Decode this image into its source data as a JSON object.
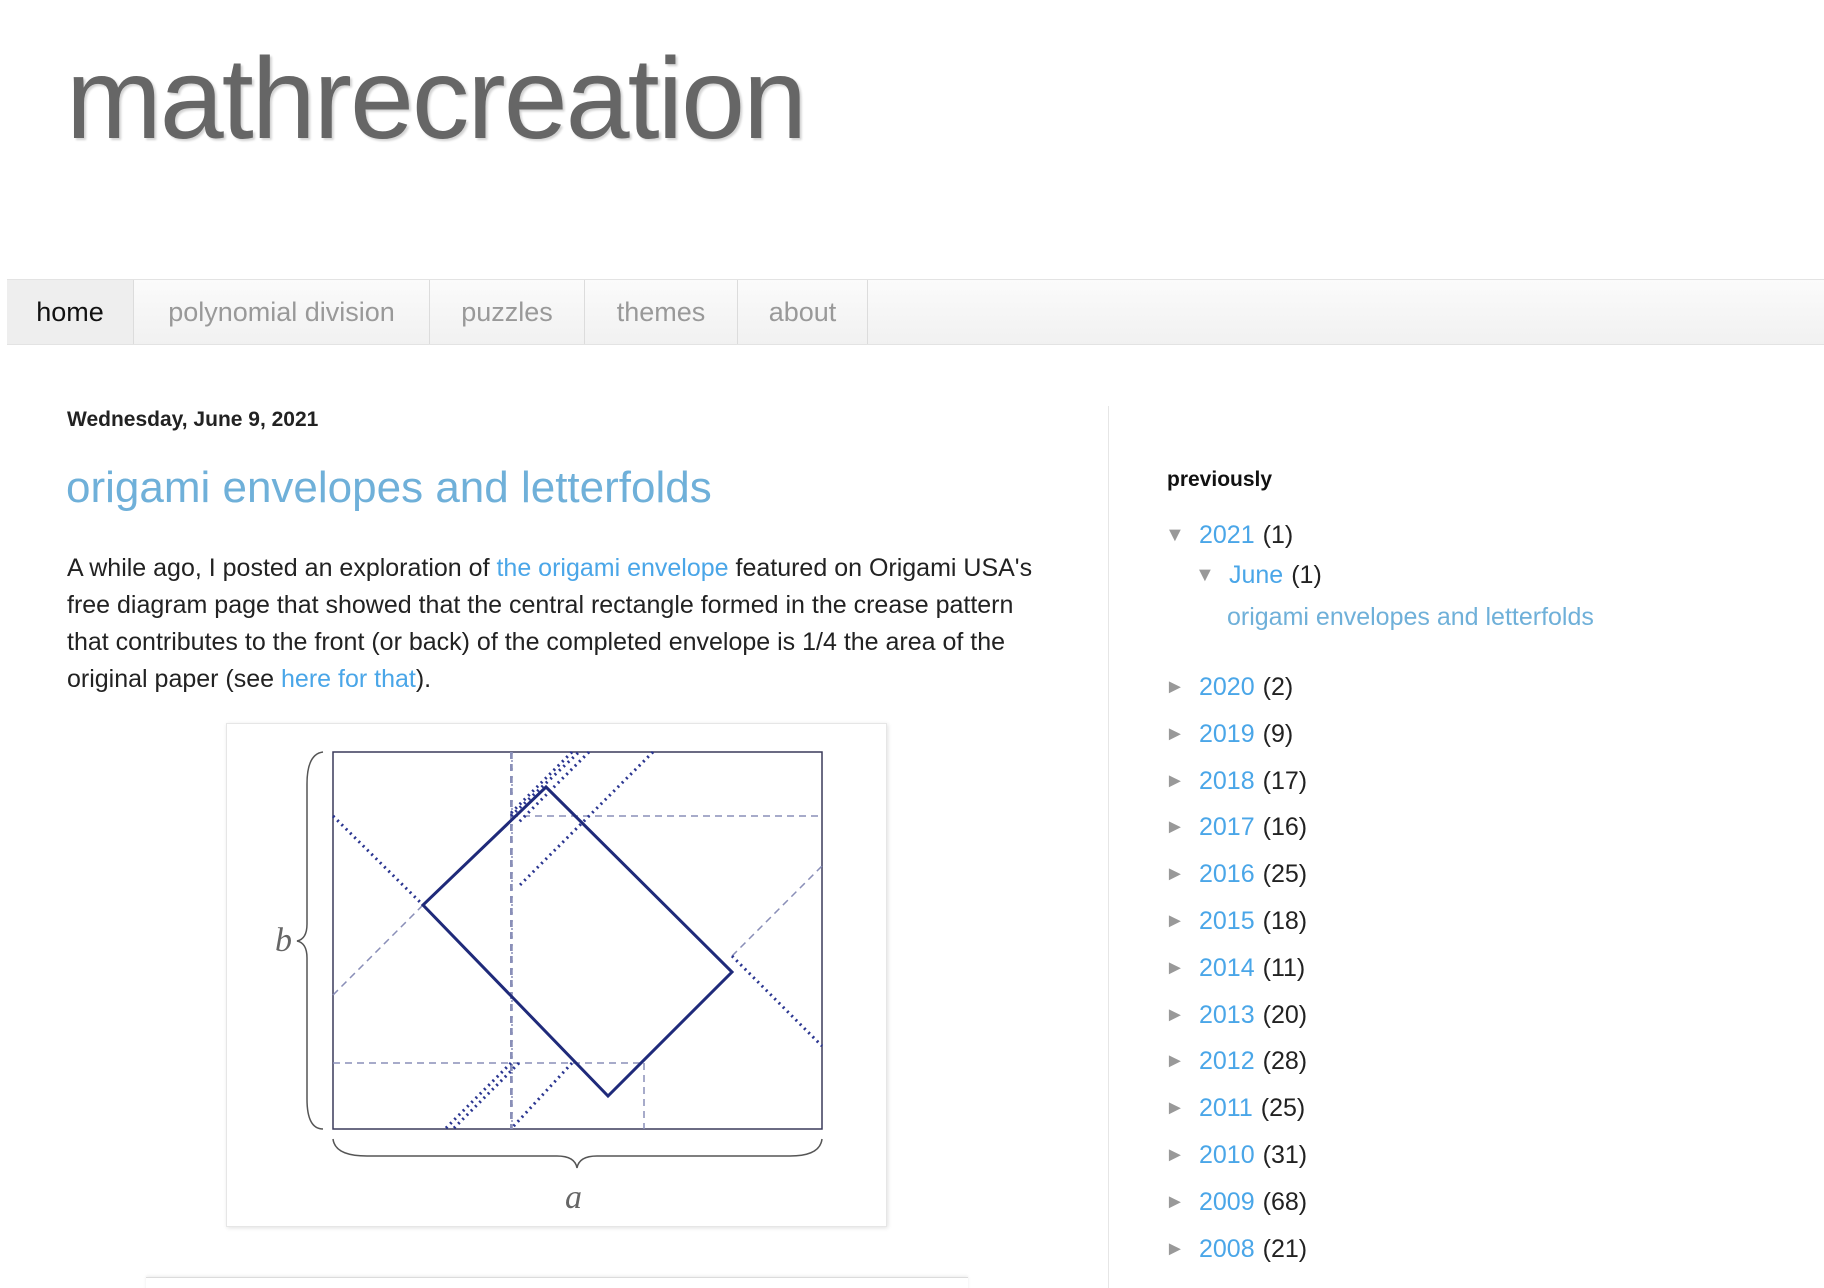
{
  "header": {
    "blog_title": "mathrecreation"
  },
  "nav": {
    "tabs": [
      {
        "label": "home",
        "active": true
      },
      {
        "label": "polynomial division",
        "active": false
      },
      {
        "label": "puzzles",
        "active": false
      },
      {
        "label": "themes",
        "active": false
      },
      {
        "label": "about",
        "active": false
      }
    ]
  },
  "post": {
    "date": "Wednesday, June 9, 2021",
    "title": "origami envelopes and letterfolds",
    "body": {
      "part1": "A while ago, I posted an exploration of ",
      "link1": "the origami envelope",
      "part2": " featured on Origami USA's free diagram page that showed that the central rectangle formed in the crease pattern that contributes to the front (or back) of the completed envelope is 1/4 the area of the original paper (see ",
      "link2": "here for that",
      "part3": ")."
    },
    "figure": {
      "label_b": "b",
      "label_a": "a"
    }
  },
  "sidebar": {
    "title": "previously",
    "archive": [
      {
        "toggle": "▼",
        "label": "2021",
        "count": "(1)",
        "level": 0
      },
      {
        "toggle": "▼",
        "label": "June",
        "count": "(1)",
        "level": 1
      },
      {
        "post": "origami envelopes and letterfolds",
        "level": 2
      },
      {
        "toggle": "►",
        "label": "2020",
        "count": "(2)",
        "level": 0
      },
      {
        "toggle": "►",
        "label": "2019",
        "count": "(9)",
        "level": 0
      },
      {
        "toggle": "►",
        "label": "2018",
        "count": "(17)",
        "level": 0
      },
      {
        "toggle": "►",
        "label": "2017",
        "count": "(16)",
        "level": 0
      },
      {
        "toggle": "►",
        "label": "2016",
        "count": "(25)",
        "level": 0
      },
      {
        "toggle": "►",
        "label": "2015",
        "count": "(18)",
        "level": 0
      },
      {
        "toggle": "►",
        "label": "2014",
        "count": "(11)",
        "level": 0
      },
      {
        "toggle": "►",
        "label": "2013",
        "count": "(20)",
        "level": 0
      },
      {
        "toggle": "►",
        "label": "2012",
        "count": "(28)",
        "level": 0
      },
      {
        "toggle": "►",
        "label": "2011",
        "count": "(25)",
        "level": 0
      },
      {
        "toggle": "►",
        "label": "2010",
        "count": "(31)",
        "level": 0
      },
      {
        "toggle": "►",
        "label": "2009",
        "count": "(68)",
        "level": 0
      },
      {
        "toggle": "►",
        "label": "2008",
        "count": "(21)",
        "level": 0
      }
    ]
  },
  "colors": {
    "link": "#4aa6e8",
    "title_link": "#6fb0d9",
    "diagram_line": "#1f2a7a"
  }
}
